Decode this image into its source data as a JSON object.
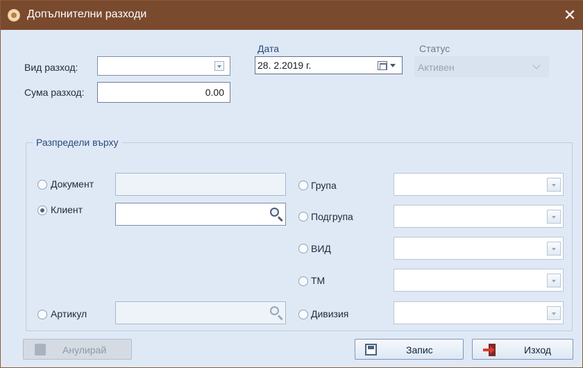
{
  "window": {
    "title": "Допълнителни разходи",
    "close_symbol": "✕",
    "icon": "app-logo-icon"
  },
  "form": {
    "expense_type_label": "Вид разход:",
    "expense_type_value": "",
    "expense_amount_label": "Сума разход:",
    "expense_amount_value": "0.00",
    "date_label": "Дата",
    "date_value": "28.  2.2019 г.",
    "status_label": "Статус",
    "status_value": "Активен"
  },
  "distribute": {
    "title": "Разпредели върху",
    "left": [
      {
        "label": "Документ",
        "checked": false,
        "value": ""
      },
      {
        "label": "Клиент",
        "checked": true,
        "value": ""
      },
      {
        "label": "Артикул",
        "checked": false,
        "value": ""
      }
    ],
    "right": [
      {
        "label": "Група",
        "checked": false,
        "value": ""
      },
      {
        "label": "Подгрупа",
        "checked": false,
        "value": ""
      },
      {
        "label": "ВИД",
        "checked": false,
        "value": ""
      },
      {
        "label": "ТМ",
        "checked": false,
        "value": ""
      },
      {
        "label": "Дивизия",
        "checked": false,
        "value": ""
      }
    ]
  },
  "buttons": {
    "cancel_label": "Анулирай",
    "save_label": "Запис",
    "exit_label": "Изход"
  },
  "colors": {
    "titlebar": "#7a4a2f",
    "window_bg": "#dfe9f5",
    "accent_text": "#274b7a"
  }
}
